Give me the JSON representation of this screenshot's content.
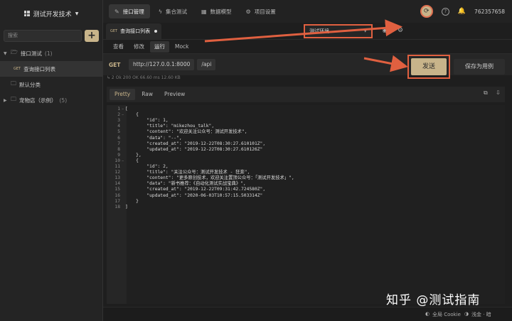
{
  "sidebar": {
    "project_name": "测试开发技术",
    "search_placeholder": "搜索",
    "add_label": "+",
    "tree": [
      {
        "label": "接口测试",
        "count": "(1)"
      },
      {
        "method": "GET",
        "label": "查询接口列表"
      },
      {
        "label": "默认分类"
      },
      {
        "label": "宠物店（示例）",
        "count": "(5)"
      }
    ]
  },
  "topnav": {
    "items": [
      "接口管理",
      "集合测试",
      "数据模型",
      "项目设置"
    ],
    "user_id": "762357658"
  },
  "request_tab": {
    "method": "GET",
    "title": "查询接口列表"
  },
  "environment": {
    "selected": "测试环境"
  },
  "subtabs": [
    "查看",
    "修改",
    "运行",
    "Mock"
  ],
  "request": {
    "method": "GET",
    "base_url": "http://127.0.0.1:8000",
    "path": "/api"
  },
  "buttons": {
    "send": "发送",
    "save_as_case": "保存为用例"
  },
  "response_status": "↳ 2 Ok 200 OK 66.60 ms 12.60 KB",
  "format_tabs": [
    "Pretty",
    "Raw",
    "Preview"
  ],
  "code_lines": [
    "[",
    "    {",
    "        \"id\": 1,",
    "        \"title\": \"mikezhou_talk\",",
    "        \"content\": \"欢迎关注公众号：测试开发技术\",",
    "        \"data\": \"--\",",
    "        \"created_at\": \"2019-12-22T08:30:27.610101Z\",",
    "        \"updated_at\": \"2019-12-22T08:30:27.610126Z\"",
    "    },",
    "    {",
    "        \"id\": 2,",
    "        \"title\": \"关注公众号：测试开发技术 - 狂奔\",",
    "        \"content\": \"更多原创技术，欢迎关注置顶公众号：「测试开发技术」\",",
    "        \"data\": \"新书推荐：《自动化测试实战宝典》\",",
    "        \"created_at\": \"2019-12-22T09:31:42.724580Z\",",
    "        \"updated_at\": \"2020-06-03T10:57:15.503314Z\"",
    "    }",
    "]"
  ],
  "footer": {
    "cookie": "全局 Cookie",
    "theme": "浅金 · 暗"
  },
  "watermark": "知乎 @测试指南",
  "colors": {
    "accent": "#c8b48a",
    "annotation": "#e06040",
    "background": "#1e1e1e"
  }
}
